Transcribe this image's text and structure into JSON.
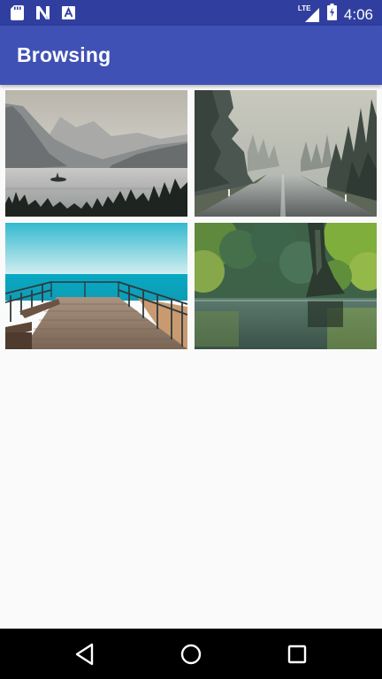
{
  "status_bar": {
    "time": "4:06",
    "network_label": "LTE",
    "left_icons": [
      "sd-card-icon",
      "n-notification-icon",
      "a-notification-icon"
    ],
    "right_icons": [
      "lte-signal-icon",
      "battery-charging-icon"
    ],
    "background_color": "#303f9f"
  },
  "app_bar": {
    "title": "Browsing",
    "background_color": "#3f51b5"
  },
  "grid": {
    "columns": 2,
    "items": [
      {
        "name": "mountain-lake-image"
      },
      {
        "name": "misty-forest-road-image"
      },
      {
        "name": "ocean-boardwalk-image"
      },
      {
        "name": "forest-pond-image"
      }
    ]
  },
  "nav_bar": {
    "buttons": [
      "back-button",
      "home-button",
      "recents-button"
    ],
    "background_color": "#000000"
  }
}
